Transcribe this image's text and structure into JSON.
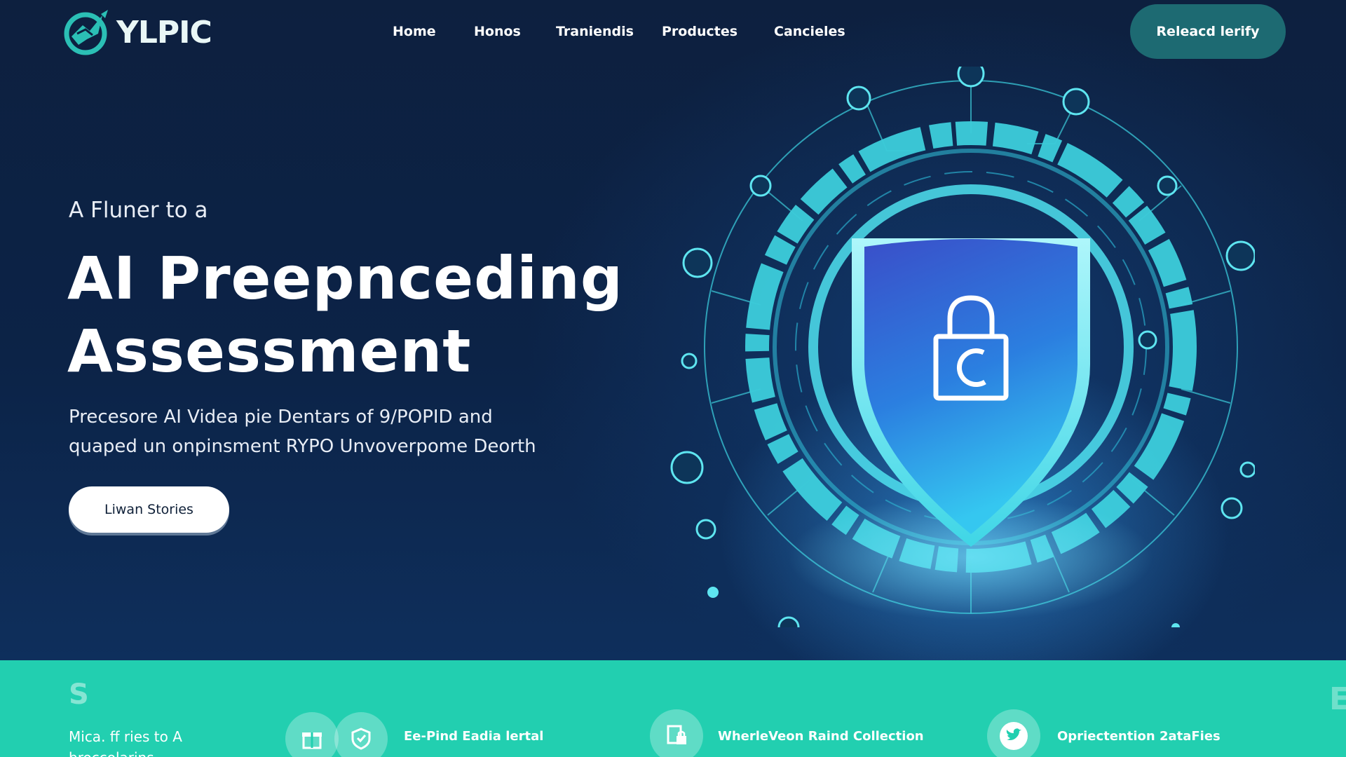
{
  "brand": {
    "name": "YLPIC",
    "logo_icon": "shield-bird-logo"
  },
  "nav": {
    "items": [
      {
        "label": "Home"
      },
      {
        "label": "Honos"
      },
      {
        "label": "Traniendis"
      },
      {
        "label": "Productes"
      },
      {
        "label": "Cancieles"
      }
    ],
    "cta_label": "Releacd lerify"
  },
  "hero": {
    "eyebrow": "A Fluner to a",
    "headline_line1": "AI Preepnceding",
    "headline_line2": "Assessment",
    "subtext_line1": "Precesore AI Videa pie Dentars of 9/POPID and",
    "subtext_line2": "quaped un onpinsment RYPO Unvoverpome Deorth",
    "cta_label": "Liwan Stories",
    "illustration_icon": "shield-padlock-icon"
  },
  "band": {
    "glyph_left": "S",
    "glyph_right": "E",
    "intro": "Mica. ff ries to A",
    "intro_line2": "broccolarins",
    "features": [
      {
        "label": "Ee-Pind Eadia lertal",
        "icons": [
          "gift-icon",
          "shield-badge-icon"
        ]
      },
      {
        "label": "WherleVeon Raind Collection",
        "icons": [
          "document-lock-icon"
        ]
      },
      {
        "label": "Opriectention 2ataFies",
        "icons": [
          "twitter-bird-icon"
        ]
      }
    ]
  },
  "colors": {
    "background": "#0b1f3f",
    "accent_teal": "#22cfb0",
    "button_teal": "#1d6a72",
    "glow_cyan": "#3fe0e8"
  }
}
